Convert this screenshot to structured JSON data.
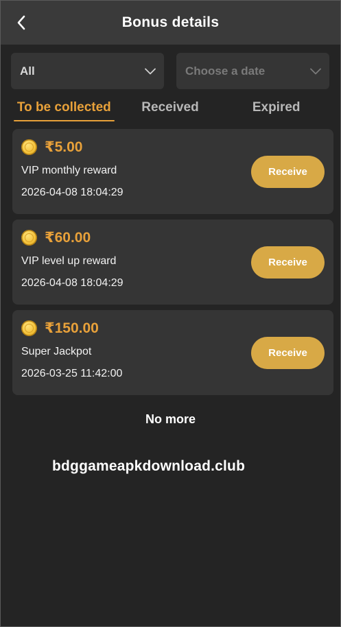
{
  "header": {
    "title": "Bonus details",
    "back_icon": "chevron-left-icon"
  },
  "filters": {
    "type": {
      "value": "All"
    },
    "date": {
      "placeholder": "Choose a date"
    }
  },
  "tabs": [
    {
      "label": "To be collected",
      "active": true
    },
    {
      "label": "Received",
      "active": false
    },
    {
      "label": "Expired",
      "active": false
    }
  ],
  "bonuses": [
    {
      "amount": "₹5.00",
      "description": "VIP monthly reward",
      "timestamp": "2026-04-08 18:04:29",
      "button": "Receive"
    },
    {
      "amount": "₹60.00",
      "description": "VIP level up reward",
      "timestamp": "2026-04-08 18:04:29",
      "button": "Receive"
    },
    {
      "amount": "₹150.00",
      "description": "Super Jackpot",
      "timestamp": "2026-03-25 11:42:00",
      "button": "Receive"
    }
  ],
  "footer": {
    "no_more": "No more",
    "watermark": "bdggameapkdownload.club"
  },
  "colors": {
    "accent": "#e8a13a",
    "button": "#d8a946",
    "background": "#242424",
    "card": "#353535"
  }
}
